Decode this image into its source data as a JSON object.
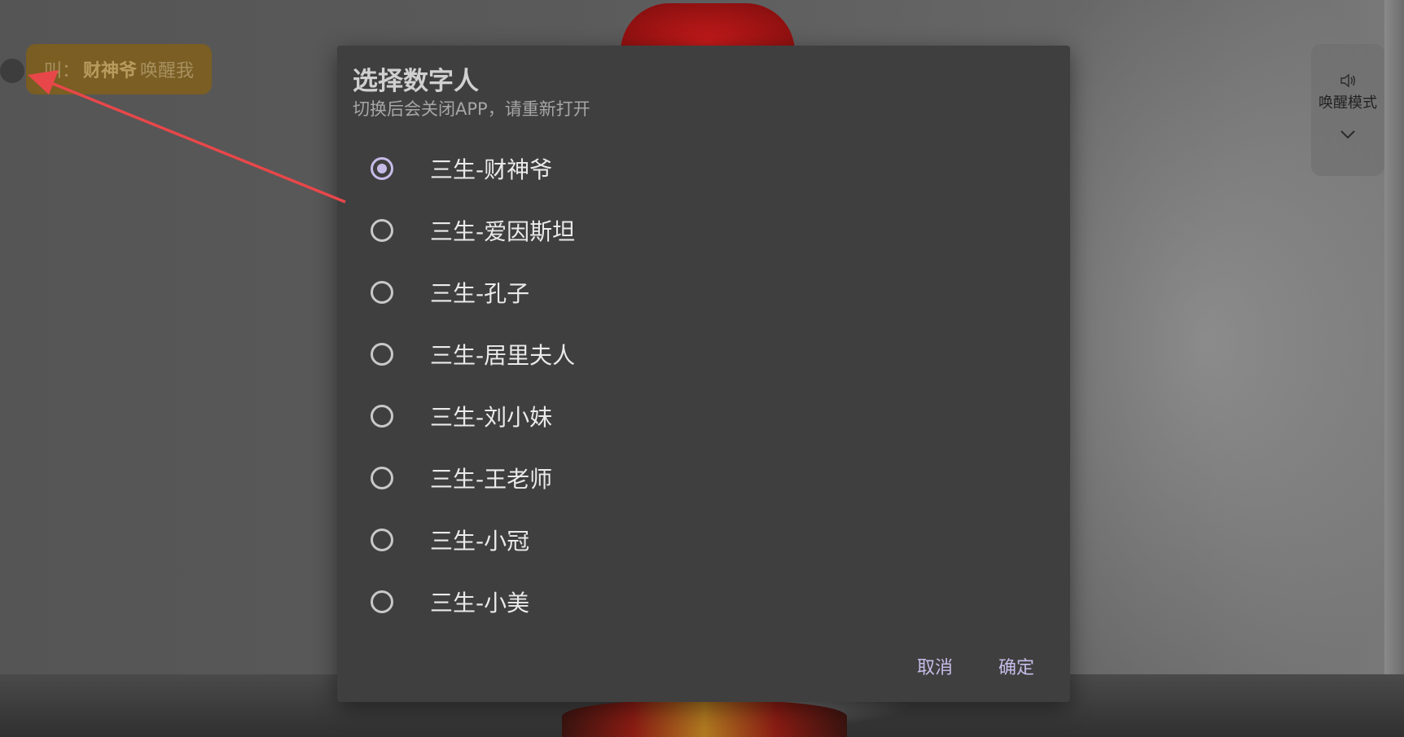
{
  "wake_tip": {
    "prefix": "叫：",
    "name": "财神爷",
    "suffix": "唤醒我"
  },
  "mode_panel": {
    "label": "唤醒模式",
    "icon": "speaker-icon",
    "expand_icon": "chevron-down-icon"
  },
  "dialog": {
    "title": "选择数字人",
    "subtitle": "切换后会关闭APP，请重新打开",
    "options": [
      {
        "label": "三生-财神爷",
        "selected": true
      },
      {
        "label": "三生-爱因斯坦",
        "selected": false
      },
      {
        "label": "三生-孔子",
        "selected": false
      },
      {
        "label": "三生-居里夫人",
        "selected": false
      },
      {
        "label": "三生-刘小妹",
        "selected": false
      },
      {
        "label": "三生-王老师",
        "selected": false
      },
      {
        "label": "三生-小冠",
        "selected": false
      },
      {
        "label": "三生-小美",
        "selected": false
      }
    ],
    "cancel_label": "取消",
    "confirm_label": "确定"
  },
  "colors": {
    "accent": "#c7bce8",
    "dialog_bg": "#3f3f3f",
    "tip_bg": "#846014",
    "arrow": "#e8474a"
  }
}
